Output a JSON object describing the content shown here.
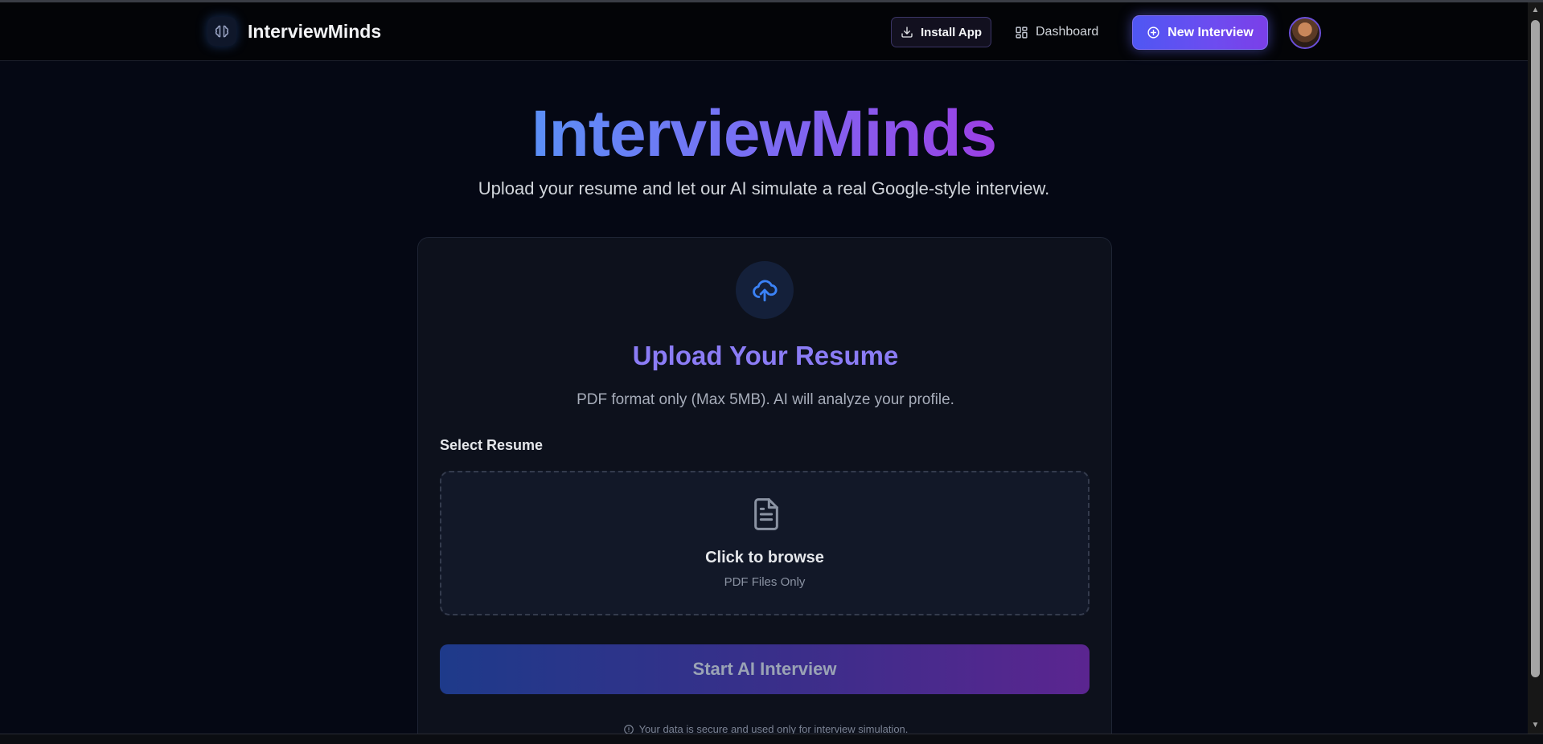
{
  "header": {
    "brand_name": "InterviewMinds",
    "install_label": "Install App",
    "dashboard_label": "Dashboard",
    "new_interview_label": "New Interview"
  },
  "hero": {
    "title": "InterviewMinds",
    "subtitle": "Upload your resume and let our AI simulate a real Google-style interview."
  },
  "card": {
    "title": "Upload Your Resume",
    "subtitle": "PDF format only (Max 5MB). AI will analyze your profile.",
    "field_label": "Select Resume",
    "dropzone_title": "Click to browse",
    "dropzone_subtitle": "PDF Files Only",
    "start_label": "Start AI Interview",
    "secure_note": "Your data is secure and used only for interview simulation."
  },
  "icons": {
    "brand": "brain-icon",
    "install": "download-icon",
    "dashboard": "dashboard-grid-icon",
    "new_interview": "plus-circle-icon",
    "upload": "cloud-upload-icon",
    "file": "file-text-icon",
    "secure": "info-icon"
  },
  "colors": {
    "background": "#050814",
    "accent_blue": "#4f57f3",
    "accent_purple": "#7b3fe8",
    "card_title": "#8b7cf6",
    "upload_icon": "#3b82f6"
  }
}
